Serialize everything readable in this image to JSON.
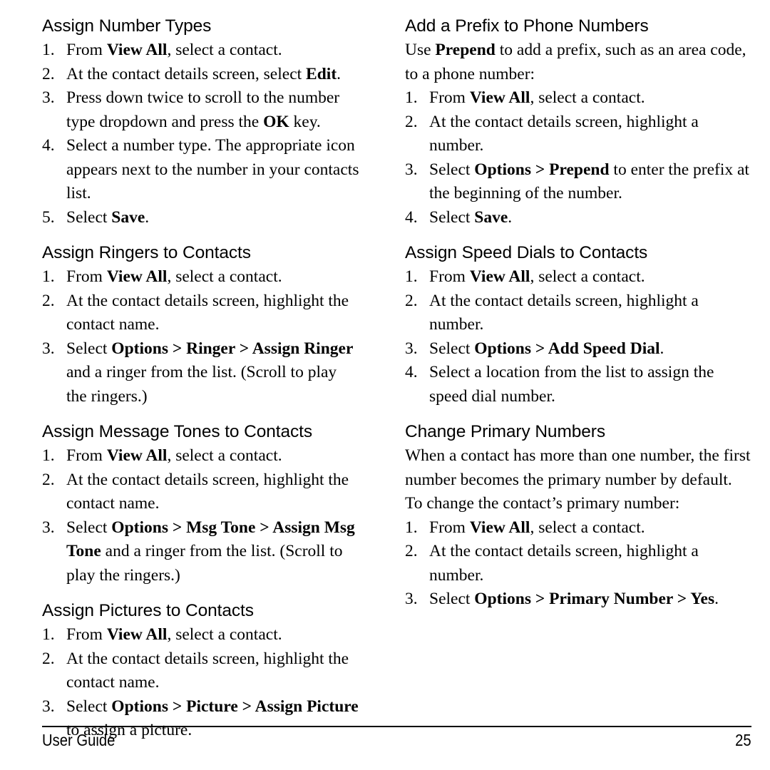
{
  "page": {
    "footer": {
      "guide_label": "User Guide",
      "page_number": "25"
    }
  },
  "left_column": {
    "sections": [
      {
        "heading": "Assign Number Types",
        "steps": [
          {
            "num": "1.",
            "parts": [
              {
                "t": "From ",
                "b": false
              },
              {
                "t": "View All",
                "b": true
              },
              {
                "t": ", select a contact.",
                "b": false
              }
            ]
          },
          {
            "num": "2.",
            "parts": [
              {
                "t": "At the contact details screen, select ",
                "b": false
              },
              {
                "t": "Edit",
                "b": true
              },
              {
                "t": ".",
                "b": false
              }
            ]
          },
          {
            "num": "3.",
            "parts": [
              {
                "t": "Press down twice to scroll to the number type dropdown and press the ",
                "b": false
              },
              {
                "t": "OK",
                "b": true
              },
              {
                "t": " key.",
                "b": false
              }
            ]
          },
          {
            "num": "4.",
            "parts": [
              {
                "t": "Select a number type. The appropriate icon appears next to the number in your contacts list.",
                "b": false
              }
            ]
          },
          {
            "num": "5.",
            "parts": [
              {
                "t": "Select ",
                "b": false
              },
              {
                "t": "Save",
                "b": true
              },
              {
                "t": ".",
                "b": false
              }
            ]
          }
        ]
      },
      {
        "heading": "Assign Ringers to Contacts",
        "steps": [
          {
            "num": "1.",
            "parts": [
              {
                "t": "From ",
                "b": false
              },
              {
                "t": "View All",
                "b": true
              },
              {
                "t": ", select a contact.",
                "b": false
              }
            ]
          },
          {
            "num": "2.",
            "parts": [
              {
                "t": "At the contact details screen, highlight the contact name.",
                "b": false
              }
            ]
          },
          {
            "num": "3.",
            "parts": [
              {
                "t": "Select ",
                "b": false
              },
              {
                "t": "Options > Ringer > Assign Ringer",
                "b": true
              },
              {
                "t": " and a ringer from the list. (Scroll to play the ringers.)",
                "b": false
              }
            ]
          }
        ]
      },
      {
        "heading": "Assign Message Tones to Contacts",
        "steps": [
          {
            "num": "1.",
            "parts": [
              {
                "t": "From ",
                "b": false
              },
              {
                "t": "View All",
                "b": true
              },
              {
                "t": ", select a contact.",
                "b": false
              }
            ]
          },
          {
            "num": "2.",
            "parts": [
              {
                "t": "At the contact details screen, highlight the contact name.",
                "b": false
              }
            ]
          },
          {
            "num": "3.",
            "parts": [
              {
                "t": "Select ",
                "b": false
              },
              {
                "t": "Options > Msg Tone > Assign Msg Tone",
                "b": true
              },
              {
                "t": " and a ringer from the list. (Scroll to play the ringers.)",
                "b": false
              }
            ]
          }
        ]
      },
      {
        "heading": "Assign Pictures to Contacts",
        "steps": [
          {
            "num": "1.",
            "parts": [
              {
                "t": "From ",
                "b": false
              },
              {
                "t": "View All",
                "b": true
              },
              {
                "t": ", select a contact.",
                "b": false
              }
            ]
          },
          {
            "num": "2.",
            "parts": [
              {
                "t": "At the contact details screen, highlight the contact name.",
                "b": false
              }
            ]
          },
          {
            "num": "3.",
            "parts": [
              {
                "t": "Select ",
                "b": false
              },
              {
                "t": "Options > Picture > Assign Picture",
                "b": true
              },
              {
                "t": " to assign a picture.",
                "b": false
              }
            ]
          }
        ]
      }
    ]
  },
  "right_column": {
    "sections": [
      {
        "heading": "Add a Prefix to Phone Numbers",
        "intro": [
          {
            "t": "Use ",
            "b": false
          },
          {
            "t": "Prepend",
            "b": true
          },
          {
            "t": " to add a prefix, such as an area code, to a phone number:",
            "b": false
          }
        ],
        "steps": [
          {
            "num": "1.",
            "parts": [
              {
                "t": "From ",
                "b": false
              },
              {
                "t": "View All",
                "b": true
              },
              {
                "t": ", select a contact.",
                "b": false
              }
            ]
          },
          {
            "num": "2.",
            "parts": [
              {
                "t": "At the contact details screen, highlight a number.",
                "b": false
              }
            ]
          },
          {
            "num": "3.",
            "parts": [
              {
                "t": "Select ",
                "b": false
              },
              {
                "t": "Options > Prepend",
                "b": true
              },
              {
                "t": " to enter the prefix at the beginning of the number.",
                "b": false
              }
            ]
          },
          {
            "num": "4.",
            "parts": [
              {
                "t": "Select ",
                "b": false
              },
              {
                "t": "Save",
                "b": true
              },
              {
                "t": ".",
                "b": false
              }
            ]
          }
        ]
      },
      {
        "heading": "Assign Speed Dials to Contacts",
        "steps": [
          {
            "num": "1.",
            "parts": [
              {
                "t": "From ",
                "b": false
              },
              {
                "t": "View All",
                "b": true
              },
              {
                "t": ", select a contact.",
                "b": false
              }
            ]
          },
          {
            "num": "2.",
            "parts": [
              {
                "t": "At the contact details screen, highlight a number.",
                "b": false
              }
            ]
          },
          {
            "num": "3.",
            "parts": [
              {
                "t": "Select ",
                "b": false
              },
              {
                "t": "Options > Add Speed Dial",
                "b": true
              },
              {
                "t": ".",
                "b": false
              }
            ]
          },
          {
            "num": "4.",
            "parts": [
              {
                "t": "Select a location from the list to assign the speed dial number.",
                "b": false
              }
            ]
          }
        ]
      },
      {
        "heading": "Change Primary Numbers",
        "intro": [
          {
            "t": "When a contact has more than one number, the first number becomes the primary number by default. To change the contact’s primary number:",
            "b": false
          }
        ],
        "steps": [
          {
            "num": "1.",
            "parts": [
              {
                "t": "From ",
                "b": false
              },
              {
                "t": "View All",
                "b": true
              },
              {
                "t": ", select a contact.",
                "b": false
              }
            ]
          },
          {
            "num": "2.",
            "parts": [
              {
                "t": "At the contact details screen, highlight a number.",
                "b": false
              }
            ]
          },
          {
            "num": "3.",
            "parts": [
              {
                "t": "Select ",
                "b": false
              },
              {
                "t": "Options > Primary Number > Yes",
                "b": true
              },
              {
                "t": ".",
                "b": false
              }
            ]
          }
        ]
      }
    ]
  }
}
